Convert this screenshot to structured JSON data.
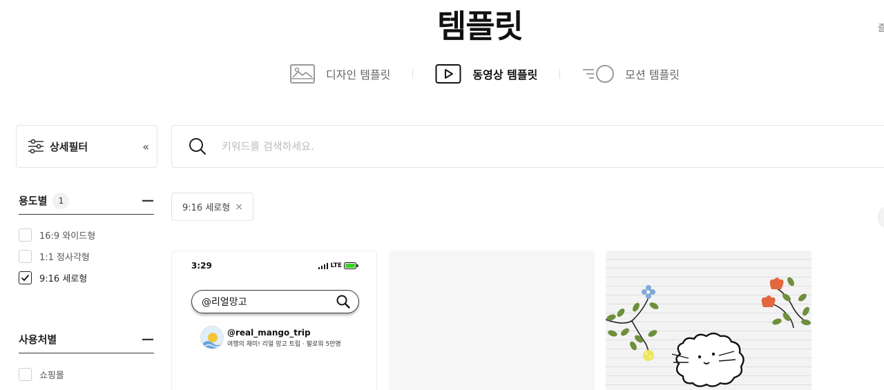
{
  "page": {
    "title": "템플릿",
    "corner_text": "즐"
  },
  "type_tabs": [
    {
      "label": "디자인 템플릿",
      "icon": "image-icon",
      "active": false
    },
    {
      "label": "동영상 템플릿",
      "icon": "play-icon",
      "active": true
    },
    {
      "label": "모션 템플릿",
      "icon": "motion-icon",
      "active": false
    }
  ],
  "filter": {
    "label": "상세필터",
    "collapse_icon": "«"
  },
  "search": {
    "placeholder": "키워드를 검색하세요."
  },
  "sections": [
    {
      "title": "용도별",
      "count": "1",
      "options": [
        {
          "label": "16:9 와이드형",
          "checked": false
        },
        {
          "label": "1:1 정사각형",
          "checked": false
        },
        {
          "label": "9:16 세로형",
          "checked": true
        }
      ]
    },
    {
      "title": "사용처별",
      "count": "",
      "options": [
        {
          "label": "쇼핑몰",
          "checked": false
        }
      ]
    }
  ],
  "active_chip": {
    "label": "9:16 세로형",
    "remove": "×"
  },
  "cards": [
    {
      "time": "3:29",
      "network": "LTE",
      "search_text": "@리얼망고",
      "handle": "@real_mango_trip",
      "description": "여행의 재미! 리얼 망고 트립 · 팔로워 5만명"
    },
    {},
    {}
  ],
  "colors": {
    "battery": "#3bd126",
    "leaf": "#6e8f3c",
    "flower_red": "#e2673f",
    "flower_blue": "#7fa9d8",
    "flower_yellow": "#efe55a"
  }
}
